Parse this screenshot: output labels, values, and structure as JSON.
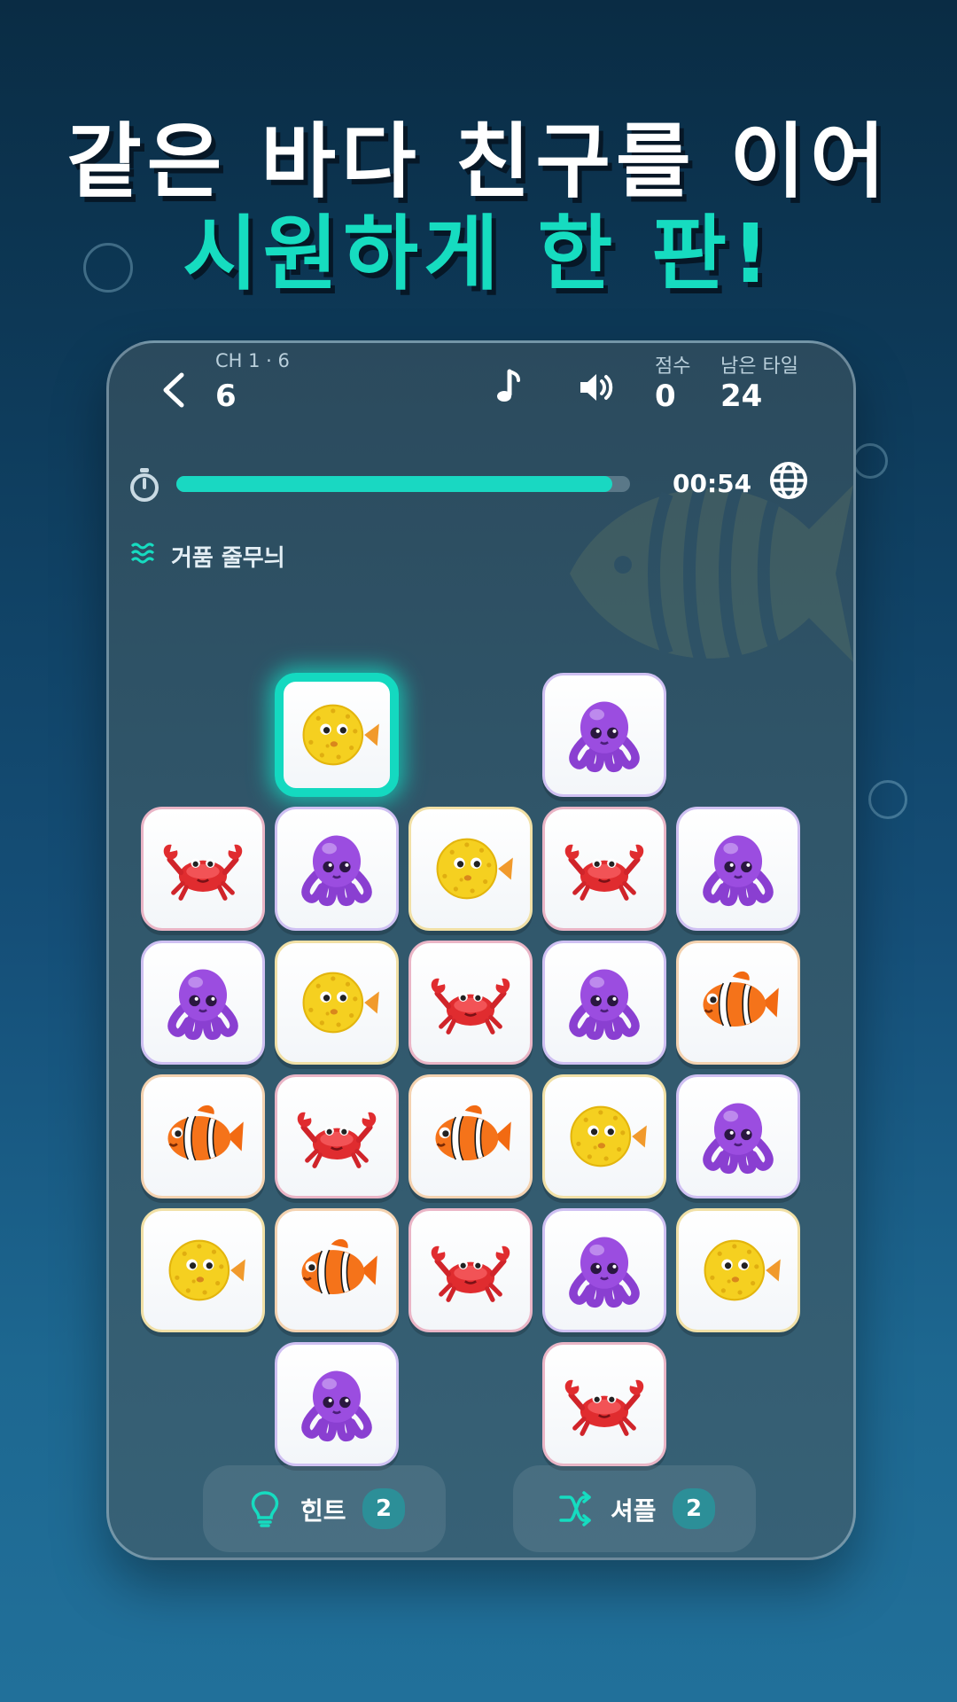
{
  "headline": {
    "line1": "같은 바다 친구를 이어",
    "line2": "시원하게 한 판!"
  },
  "header": {
    "chapter_label": "CH 1 · 6",
    "level": "6",
    "score_label": "점수",
    "score": "0",
    "remaining_label": "남은 타일",
    "remaining": "24"
  },
  "timer": {
    "time": "00:54",
    "progress": 0.96
  },
  "level_name": "거품 줄무늬",
  "tiles": [
    {
      "row": 0,
      "col": 1,
      "type": "puffer",
      "selected": true
    },
    {
      "row": 0,
      "col": 3,
      "type": "octopus"
    },
    {
      "row": 1,
      "col": 0,
      "type": "crab"
    },
    {
      "row": 1,
      "col": 1,
      "type": "octopus"
    },
    {
      "row": 1,
      "col": 2,
      "type": "puffer"
    },
    {
      "row": 1,
      "col": 3,
      "type": "crab"
    },
    {
      "row": 1,
      "col": 4,
      "type": "octopus"
    },
    {
      "row": 2,
      "col": 0,
      "type": "octopus"
    },
    {
      "row": 2,
      "col": 1,
      "type": "puffer"
    },
    {
      "row": 2,
      "col": 2,
      "type": "crab"
    },
    {
      "row": 2,
      "col": 3,
      "type": "octopus"
    },
    {
      "row": 2,
      "col": 4,
      "type": "clown"
    },
    {
      "row": 3,
      "col": 0,
      "type": "clown"
    },
    {
      "row": 3,
      "col": 1,
      "type": "crab"
    },
    {
      "row": 3,
      "col": 2,
      "type": "clown"
    },
    {
      "row": 3,
      "col": 3,
      "type": "puffer"
    },
    {
      "row": 3,
      "col": 4,
      "type": "octopus"
    },
    {
      "row": 4,
      "col": 0,
      "type": "puffer"
    },
    {
      "row": 4,
      "col": 1,
      "type": "clown"
    },
    {
      "row": 4,
      "col": 2,
      "type": "crab"
    },
    {
      "row": 4,
      "col": 3,
      "type": "octopus"
    },
    {
      "row": 4,
      "col": 4,
      "type": "puffer"
    },
    {
      "row": 5,
      "col": 1,
      "type": "octopus"
    },
    {
      "row": 5,
      "col": 3,
      "type": "crab"
    }
  ],
  "actions": {
    "hint_label": "힌트",
    "hint_count": "2",
    "shuffle_label": "셔플",
    "shuffle_count": "2"
  },
  "colors": {
    "accent": "#16dcc0",
    "panel": "#30566a",
    "badge": "#2c8f98"
  }
}
